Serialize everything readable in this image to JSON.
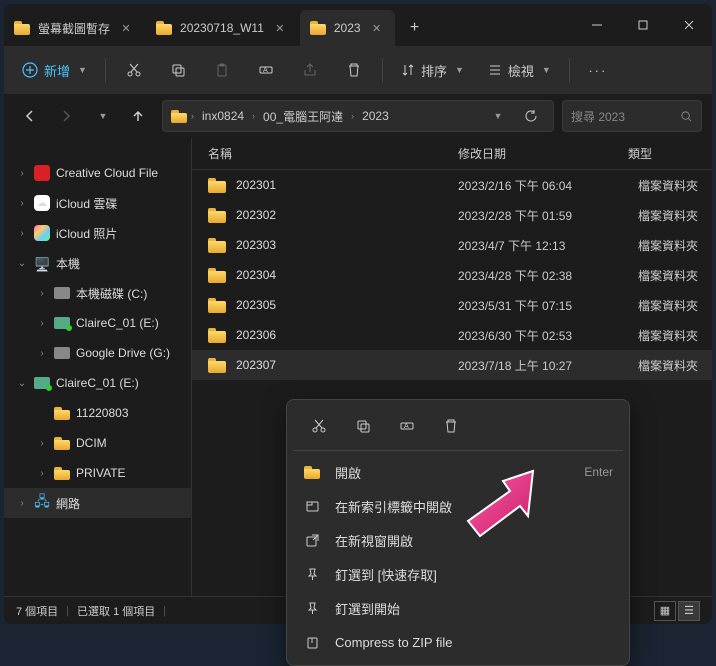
{
  "tabs": [
    {
      "label": "螢幕截圖暫存",
      "active": false
    },
    {
      "label": "20230718_W11",
      "active": false
    },
    {
      "label": "2023",
      "active": true
    }
  ],
  "toolbar": {
    "new_label": "新增",
    "sort_label": "排序",
    "view_label": "檢視"
  },
  "breadcrumb": [
    "inx0824",
    "00_電腦王阿達",
    "2023"
  ],
  "search_placeholder": "搜尋 2023",
  "columns": {
    "name": "名稱",
    "date": "修改日期",
    "type": "類型"
  },
  "sidebar": [
    {
      "label": "Creative Cloud File",
      "arrow": "right",
      "icon": "cc",
      "indent": 0
    },
    {
      "label": "iCloud 雲碟",
      "arrow": "right",
      "icon": "icloud",
      "indent": 0
    },
    {
      "label": "iCloud 照片",
      "arrow": "right",
      "icon": "photos",
      "indent": 0
    },
    {
      "label": "本機",
      "arrow": "down",
      "icon": "pc",
      "indent": 0
    },
    {
      "label": "本機磁碟 (C:)",
      "arrow": "right",
      "icon": "drive",
      "indent": 1
    },
    {
      "label": "ClaireC_01 (E:)",
      "arrow": "right",
      "icon": "drive-ext",
      "indent": 1
    },
    {
      "label": "Google Drive (G:)",
      "arrow": "right",
      "icon": "drive",
      "indent": 1
    },
    {
      "label": "ClaireC_01 (E:)",
      "arrow": "down",
      "icon": "drive-ext",
      "indent": 0
    },
    {
      "label": "11220803",
      "arrow": "",
      "icon": "folder",
      "indent": 1
    },
    {
      "label": "DCIM",
      "arrow": "right",
      "icon": "folder",
      "indent": 1
    },
    {
      "label": "PRIVATE",
      "arrow": "right",
      "icon": "folder",
      "indent": 1
    },
    {
      "label": "網路",
      "arrow": "right",
      "icon": "network",
      "indent": 0,
      "selected": true
    }
  ],
  "files": [
    {
      "name": "202301",
      "date": "2023/2/16 下午 06:04",
      "type": "檔案資料夾"
    },
    {
      "name": "202302",
      "date": "2023/2/28 下午 01:59",
      "type": "檔案資料夾"
    },
    {
      "name": "202303",
      "date": "2023/4/7 下午 12:13",
      "type": "檔案資料夾"
    },
    {
      "name": "202304",
      "date": "2023/4/28 下午 02:38",
      "type": "檔案資料夾"
    },
    {
      "name": "202305",
      "date": "2023/5/31 下午 07:15",
      "type": "檔案資料夾"
    },
    {
      "name": "202306",
      "date": "2023/6/30 下午 02:53",
      "type": "檔案資料夾"
    },
    {
      "name": "202307",
      "date": "2023/7/18 上午 10:27",
      "type": "檔案資料夾",
      "selected": true
    }
  ],
  "status": {
    "items": "7 個項目",
    "selected": "已選取 1 個項目"
  },
  "context_menu": {
    "open": "開啟",
    "open_shortcut": "Enter",
    "open_new_tab": "在新索引標籤中開啟",
    "open_new_window": "在新視窗開啟",
    "pin_quick": "釘選到 [快速存取]",
    "pin_start": "釘選到開始",
    "compress": "Compress to ZIP file"
  }
}
